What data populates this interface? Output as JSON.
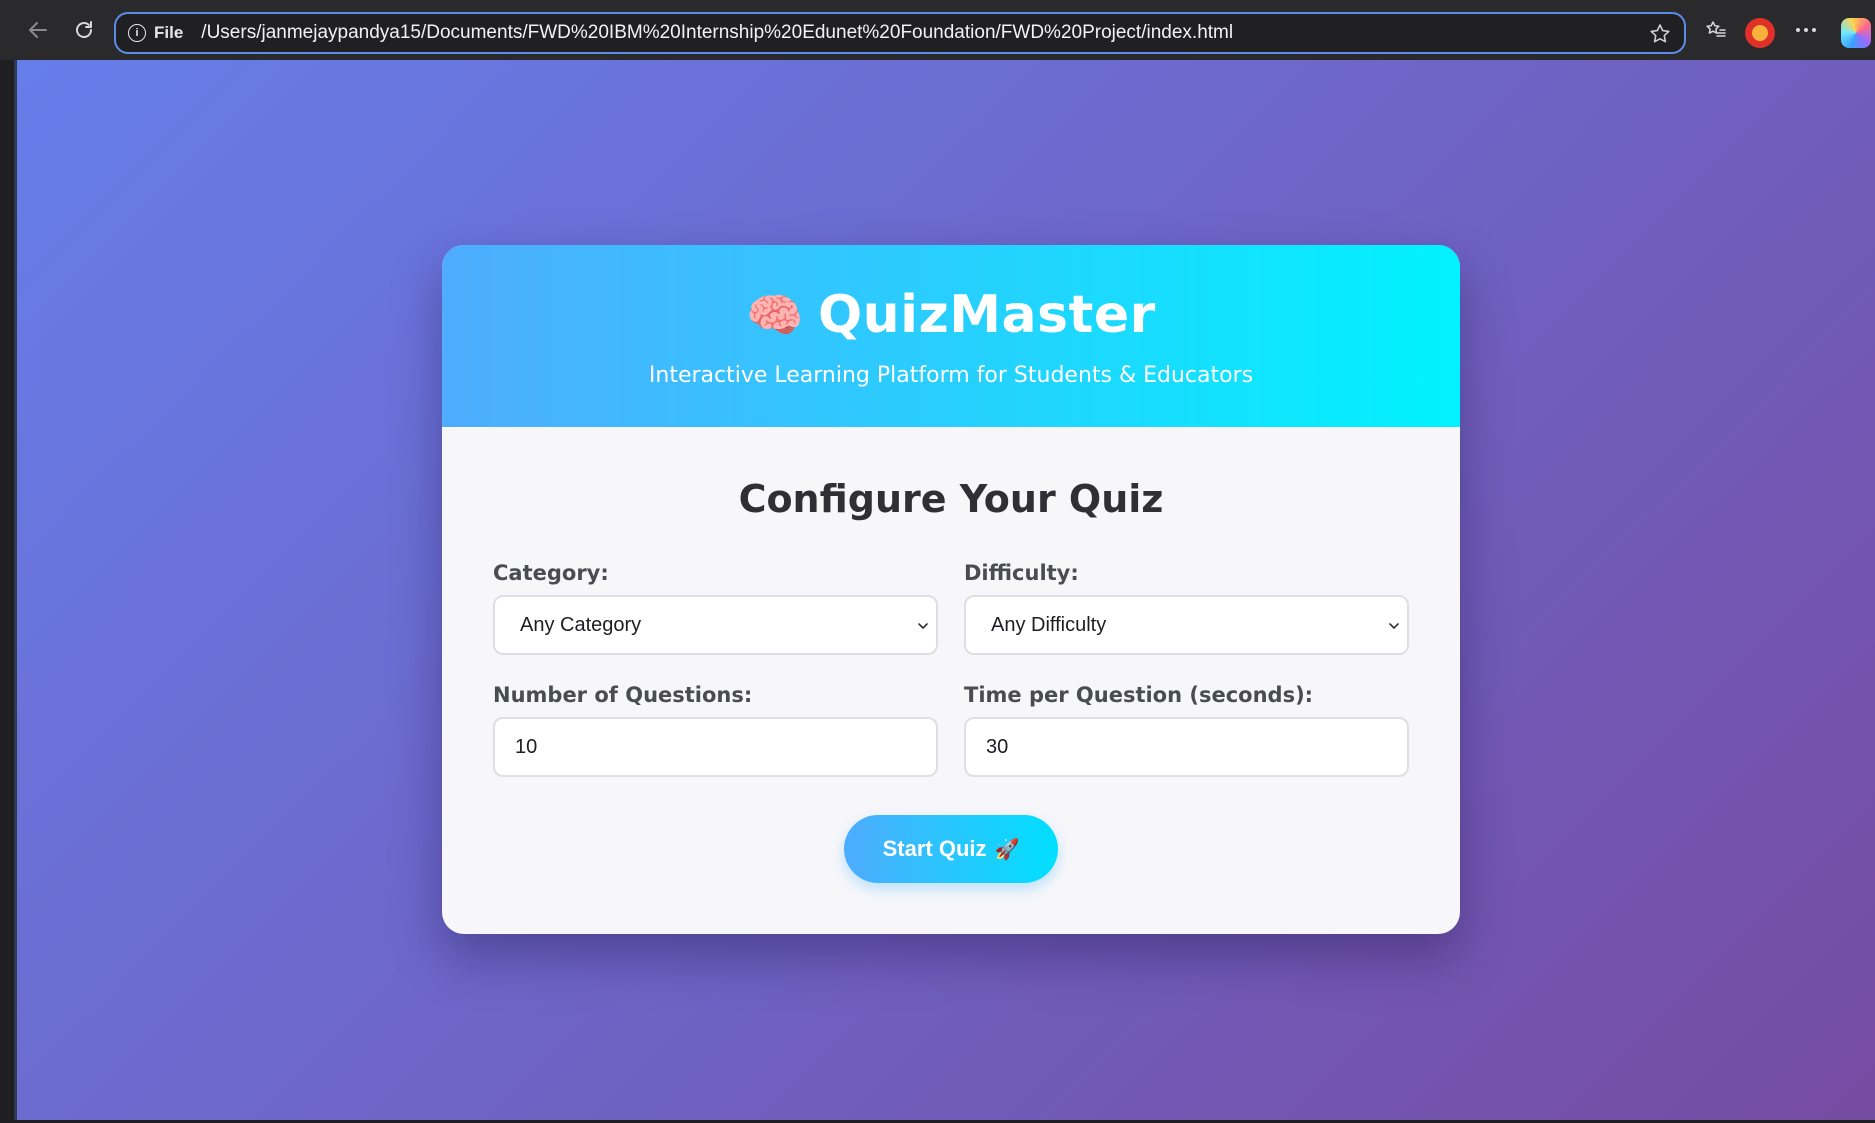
{
  "browser": {
    "address_prefix": "File",
    "url": "/Users/janmejaypandya15/Documents/FWD%20IBM%20Internship%20Edunet%20Foundation/FWD%20Project/index.html",
    "icons": {
      "back": "back-arrow-icon",
      "reload": "reload-icon",
      "info": "info-icon",
      "favorite": "star-icon",
      "favorites_list": "favorites-icon",
      "more": "more-icon",
      "copilot": "copilot-icon"
    }
  },
  "app": {
    "icon": "🧠",
    "title": "QuizMaster",
    "subtitle": "Interactive Learning Platform for Students & Educators"
  },
  "config": {
    "heading": "Configure Your Quiz",
    "category_label": "Category:",
    "category_value": "Any Category",
    "difficulty_label": "Difficulty:",
    "difficulty_value": "Any Difficulty",
    "num_questions_label": "Number of Questions:",
    "num_questions_value": "10",
    "time_label": "Time per Question (seconds):",
    "time_value": "30",
    "start_label": "Start Quiz",
    "start_icon": "🚀"
  },
  "colors": {
    "bg_gradient_start": "#667eea",
    "bg_gradient_end": "#764ba2",
    "header_gradient_start": "#4facfe",
    "header_gradient_end": "#00f2fe"
  }
}
